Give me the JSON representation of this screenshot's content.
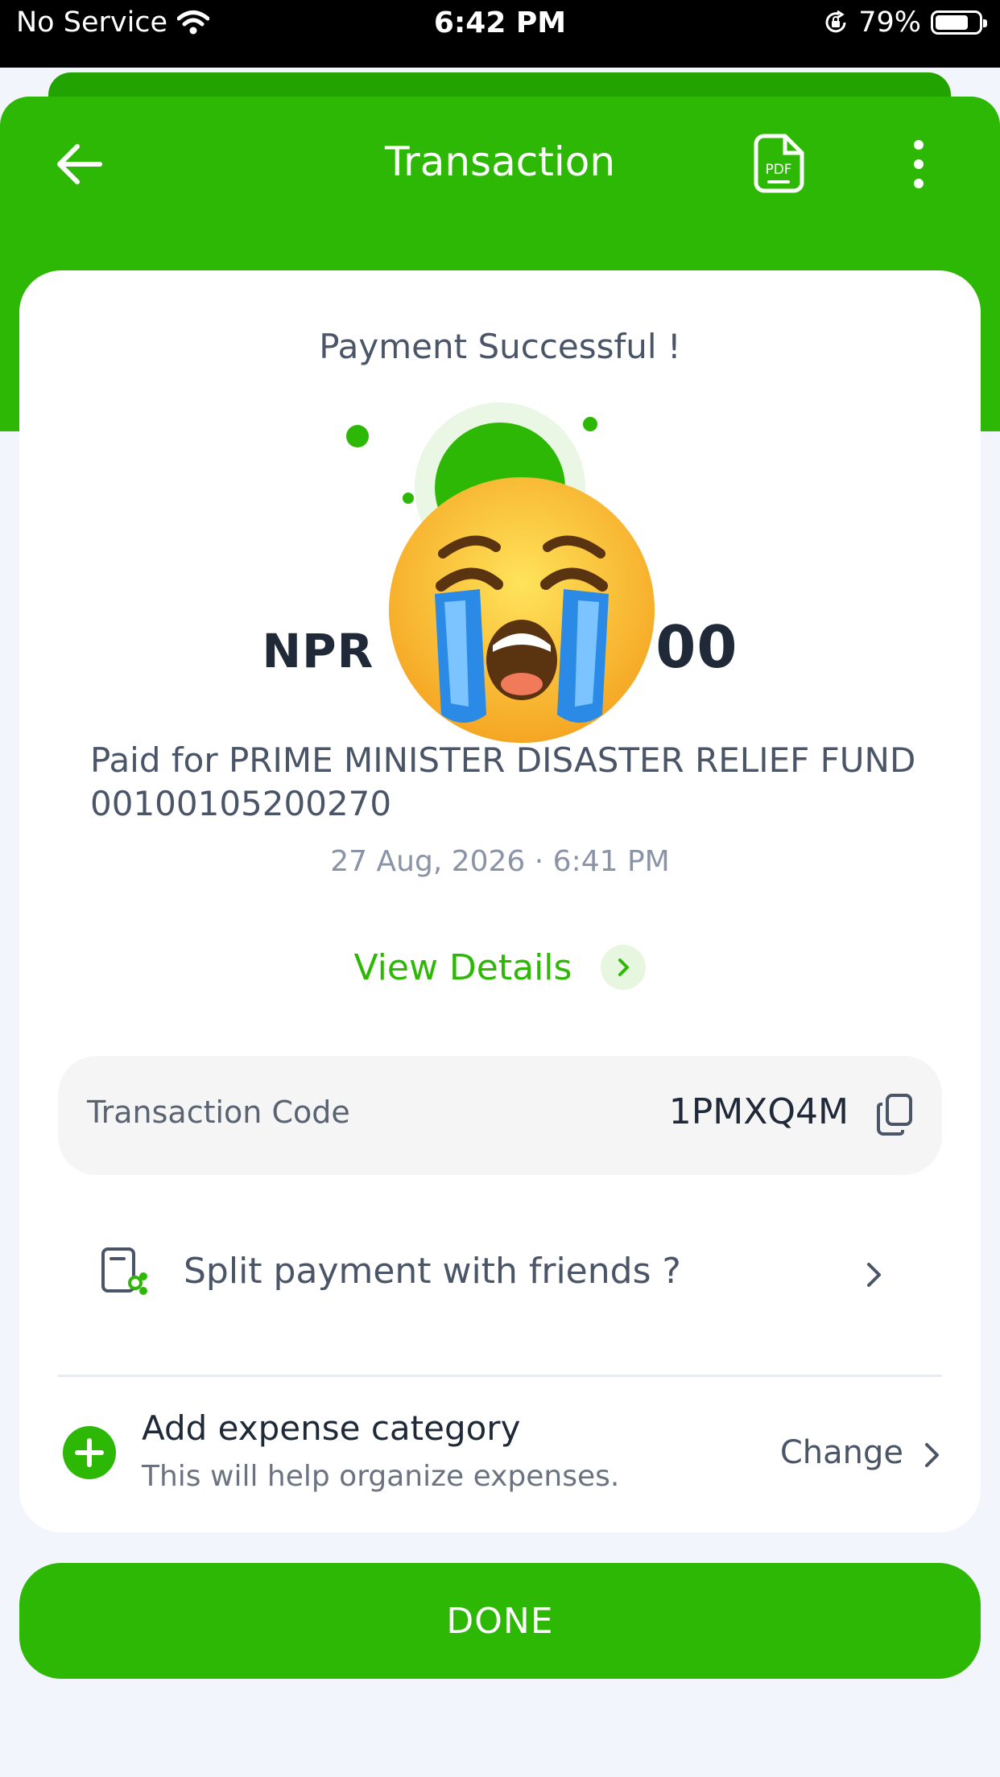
{
  "status_bar": {
    "carrier": "No Service",
    "time": "6:42 PM",
    "battery": "79%",
    "battery_level": 0.79
  },
  "header": {
    "title": "Transaction",
    "pdf_icon_text": "PDF"
  },
  "result": {
    "title": "Payment Successful !",
    "currency": "NPR",
    "amount_visible_suffix": "00"
  },
  "payment": {
    "paid_for": "Paid for PRIME MINISTER DISASTER RELIEF FUND 00100105200270",
    "datetime": "27 Aug, 2026 · 6:41 PM",
    "view_details_label": "View Details"
  },
  "transaction": {
    "code_label": "Transaction Code",
    "code_value": "1PMXQ4M"
  },
  "split": {
    "label": "Split payment with friends ?"
  },
  "expense": {
    "title": "Add expense category",
    "subtitle": "This will help organize expenses.",
    "change_label": "Change"
  },
  "done_label": "DONE",
  "colors": {
    "brand_green": "#2eb806",
    "text_dark": "#1f2937",
    "text_gray": "#4a5568",
    "background": "#f2f5fb"
  },
  "icons": [
    "wifi-icon",
    "rotation-lock-icon",
    "battery-icon",
    "back-arrow-icon",
    "pdf-icon",
    "more-vertical-icon",
    "success-check-icon",
    "crying-face-emoji",
    "chevron-right-icon",
    "copy-icon",
    "split-bill-icon",
    "plus-circle-icon"
  ]
}
